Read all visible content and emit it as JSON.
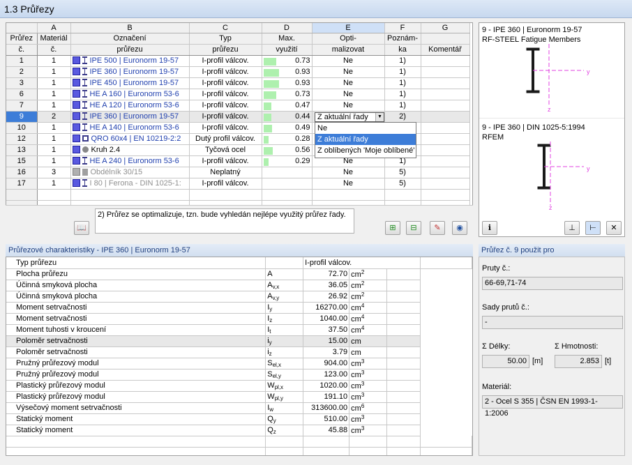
{
  "title": "1.3 Průřezy",
  "col_letters": [
    "A",
    "B",
    "C",
    "D",
    "E",
    "F",
    "G"
  ],
  "headers": {
    "num": [
      "Průřez",
      "č."
    ],
    "A": [
      "Materiál",
      "č."
    ],
    "B": [
      "Označení",
      "průřezu"
    ],
    "C": [
      "Typ",
      "průřezu"
    ],
    "D": [
      "Max.",
      "využití"
    ],
    "E": [
      "Opti-",
      "malizovat"
    ],
    "F": [
      "Poznám-",
      "ka"
    ],
    "G": [
      "",
      "Komentář"
    ]
  },
  "rows": [
    {
      "num": "1",
      "mat": "1",
      "name": "IPE 500 | Euronorm 19-57",
      "type": "I-profil válcov.",
      "util": "0.73",
      "utilv": 0.73,
      "opt": "Ne",
      "note": "1)",
      "icon": "i-beam"
    },
    {
      "num": "2",
      "mat": "1",
      "name": "IPE 360 | Euronorm 19-57",
      "type": "I-profil válcov.",
      "util": "0.93",
      "utilv": 0.93,
      "opt": "Ne",
      "note": "1)",
      "icon": "i-beam"
    },
    {
      "num": "3",
      "mat": "1",
      "name": "IPE 450 | Euronorm 19-57",
      "type": "I-profil válcov.",
      "util": "0.93",
      "utilv": 0.93,
      "opt": "Ne",
      "note": "1)",
      "icon": "i-beam"
    },
    {
      "num": "6",
      "mat": "1",
      "name": "HE A 160 | Euronorm 53-6",
      "type": "I-profil válcov.",
      "util": "0.73",
      "utilv": 0.73,
      "opt": "Ne",
      "note": "1)",
      "icon": "i-beam"
    },
    {
      "num": "7",
      "mat": "1",
      "name": "HE A 120 | Euronorm 53-6",
      "type": "I-profil válcov.",
      "util": "0.47",
      "utilv": 0.47,
      "opt": "Ne",
      "note": "1)",
      "icon": "i-beam"
    },
    {
      "num": "9",
      "mat": "2",
      "name": "IPE 360 | Euronorm 19-57",
      "type": "I-profil válcov.",
      "util": "0.44",
      "utilv": 0.44,
      "opt": "",
      "note": "2)",
      "icon": "i-beam",
      "selected": true
    },
    {
      "num": "10",
      "mat": "1",
      "name": "HE A 140 | Euronorm 53-6",
      "type": "I-profil válcov.",
      "util": "0.49",
      "utilv": 0.49,
      "opt": "",
      "note": "",
      "icon": "i-beam"
    },
    {
      "num": "12",
      "mat": "1",
      "name": "QRO 60x4 | EN 10219-2:2",
      "type": "Dutý profil válcov.",
      "util": "0.28",
      "utilv": 0.28,
      "opt": "",
      "note": "",
      "icon": "hollow"
    },
    {
      "num": "13",
      "mat": "1",
      "name": "Kruh 2.4",
      "type": "Tyčová ocel",
      "util": "0.56",
      "utilv": 0.56,
      "opt": "",
      "note": "",
      "icon": "circle",
      "black": true
    },
    {
      "num": "15",
      "mat": "1",
      "name": "HE A 240 | Euronorm 53-6",
      "type": "I-profil válcov.",
      "util": "0.29",
      "utilv": 0.29,
      "opt": "Ne",
      "note": "1)",
      "icon": "i-beam"
    },
    {
      "num": "16",
      "mat": "3",
      "name": "Obdélník 30/15",
      "type": "Neplatný",
      "util": "",
      "utilv": 0,
      "opt": "Ne",
      "note": "5)",
      "icon": "rect",
      "grayed": true
    },
    {
      "num": "17",
      "mat": "1",
      "name": "I 80 | Ferona - DIN 1025-1:",
      "type": "I-profil válcov.",
      "util": "",
      "utilv": 0,
      "opt": "Ne",
      "note": "5)",
      "icon": "i-beam",
      "grayed": true
    }
  ],
  "combo_value": "Z aktuální řady",
  "dropdown_options": [
    "Ne",
    "Z aktuální řady",
    "Z oblíbených 'Moje oblíbené'"
  ],
  "note_text": "2) Průřez se optimalizuje, tzn. bude vyhledán nejlépe využitý průřez řady.",
  "preview": {
    "top_title1": "9 - IPE 360 | Euronorm 19-57",
    "top_title2": "RF-STEEL Fatigue Members",
    "bottom_title1": "9 - IPE 360 | DIN 1025-5:1994",
    "bottom_title2": "RFEM",
    "axis_y": "y",
    "axis_z": "z"
  },
  "props_header": "Průřezové charakteristiky  -  IPE 360 | Euronorm 19-57",
  "props": [
    {
      "name": "Typ průřezu",
      "sym": "",
      "sub": "",
      "val": "I-profil válcov.",
      "unit": "",
      "sup": ""
    },
    {
      "name": "Plocha průřezu",
      "sym": "A",
      "sub": "",
      "val": "72.70",
      "unit": "cm",
      "sup": "2"
    },
    {
      "name": "Účinná smyková plocha",
      "sym": "A",
      "sub": "v,x",
      "val": "36.05",
      "unit": "cm",
      "sup": "2"
    },
    {
      "name": "Účinná smyková plocha",
      "sym": "A",
      "sub": "v,y",
      "val": "26.92",
      "unit": "cm",
      "sup": "2"
    },
    {
      "name": "Moment setrvačnosti",
      "sym": "I",
      "sub": "y",
      "val": "16270.00",
      "unit": "cm",
      "sup": "4"
    },
    {
      "name": "Moment setrvačnosti",
      "sym": "I",
      "sub": "z",
      "val": "1040.00",
      "unit": "cm",
      "sup": "4"
    },
    {
      "name": "Moment tuhosti v kroucení",
      "sym": "I",
      "sub": "t",
      "val": "37.50",
      "unit": "cm",
      "sup": "4"
    },
    {
      "name": "Poloměr setrvačnosti",
      "sym": "i",
      "sub": "y",
      "val": "15.00",
      "unit": "cm",
      "sup": "",
      "hl": true
    },
    {
      "name": "Poloměr setrvačnosti",
      "sym": "i",
      "sub": "z",
      "val": "3.79",
      "unit": "cm",
      "sup": ""
    },
    {
      "name": "Pružný průřezový modul",
      "sym": "S",
      "sub": "el,x",
      "val": "904.00",
      "unit": "cm",
      "sup": "3"
    },
    {
      "name": "Pružný průřezový modul",
      "sym": "S",
      "sub": "el,y",
      "val": "123.00",
      "unit": "cm",
      "sup": "3"
    },
    {
      "name": "Plastický průřezový modul",
      "sym": "W",
      "sub": "pl,x",
      "val": "1020.00",
      "unit": "cm",
      "sup": "3"
    },
    {
      "name": "Plastický průřezový modul",
      "sym": "W",
      "sub": "pl,y",
      "val": "191.10",
      "unit": "cm",
      "sup": "3"
    },
    {
      "name": "Výsečový moment setrvačnosti",
      "sym": "I",
      "sub": "w",
      "val": "313600.00",
      "unit": "cm",
      "sup": "6"
    },
    {
      "name": "Statický moment",
      "sym": "Q",
      "sub": "y",
      "val": "510.00",
      "unit": "cm",
      "sup": "3"
    },
    {
      "name": "Statický moment",
      "sym": "Q",
      "sub": "z",
      "val": "45.88",
      "unit": "cm",
      "sup": "3"
    }
  ],
  "side": {
    "header": "Průřez č. 9 použit pro",
    "members_label": "Pruty č.:",
    "members_value": "66-69,71-74",
    "sets_label": "Sady prutů č.:",
    "sets_value": "-",
    "length_label": "Σ  Délky:",
    "length_value": "50.00",
    "length_unit": "[m]",
    "mass_label": "Σ  Hmotnosti:",
    "mass_value": "2.853",
    "mass_unit": "[t]",
    "material_label": "Materiál:",
    "material_value": "2 - Ocel S 355 | ČSN EN 1993-1-1:2006"
  }
}
